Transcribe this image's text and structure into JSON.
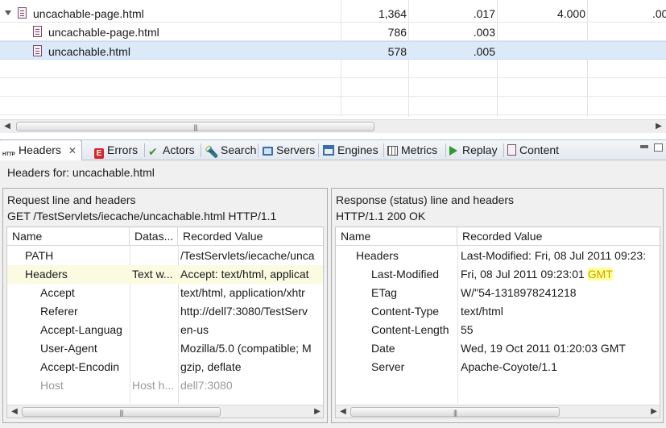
{
  "top_table": {
    "rows": [
      {
        "name": "uncachable-page.html",
        "size": "1,364",
        "time": ".017",
        "col4": "4.000",
        "col5": ".00",
        "expanded": true
      },
      {
        "name": "uncachable-page.html",
        "size": "786",
        "time": ".003",
        "col4": "",
        "col5": ""
      },
      {
        "name": "uncachable.html",
        "size": "578",
        "time": ".005",
        "col4": "",
        "col5": "",
        "selected": true
      }
    ]
  },
  "tabs": [
    {
      "label": "Headers",
      "icon": "http-icon",
      "active": true
    },
    {
      "label": "Errors",
      "icon": "error-icon"
    },
    {
      "label": "Actors",
      "icon": "checkmark-icon"
    },
    {
      "label": "Search",
      "icon": "flashlight-icon"
    },
    {
      "label": "Servers",
      "icon": "monitor-icon"
    },
    {
      "label": "Engines",
      "icon": "engine-icon"
    },
    {
      "label": "Metrics",
      "icon": "grid-icon"
    },
    {
      "label": "Replay",
      "icon": "play-icon"
    },
    {
      "label": "Content",
      "icon": "document-icon"
    }
  ],
  "headers_view": {
    "title": "Headers for: uncachable.html",
    "request": {
      "heading": "Request line and headers",
      "line": "GET /TestServlets/iecache/uncachable.html HTTP/1.1",
      "columns": [
        "Name",
        "Datas...",
        "Recorded Value"
      ],
      "rows": [
        {
          "name": "PATH",
          "datasource": "",
          "value": "/TestServlets/iecache/unca",
          "indent": 1
        },
        {
          "name": "Headers",
          "datasource": "Text w...",
          "value": "Accept: text/html, applicat",
          "indent": 1,
          "highlight": true
        },
        {
          "name": "Accept",
          "datasource": "",
          "value": "text/html, application/xhtr",
          "indent": 2
        },
        {
          "name": "Referer",
          "datasource": "",
          "value": "http://dell7:3080/TestServ",
          "indent": 2
        },
        {
          "name": "Accept-Languag",
          "datasource": "",
          "value": "en-us",
          "indent": 2
        },
        {
          "name": "User-Agent",
          "datasource": "",
          "value": "Mozilla/5.0 (compatible; M",
          "indent": 2
        },
        {
          "name": "Accept-Encodin",
          "datasource": "",
          "value": "gzip, deflate",
          "indent": 2
        },
        {
          "name": "Host",
          "datasource": "Host h...",
          "value": "dell7:3080",
          "indent": 2,
          "muted": true
        }
      ]
    },
    "response": {
      "heading": "Response (status) line and headers",
      "line": "HTTP/1.1 200 OK",
      "columns": [
        "Name",
        "Recorded Value"
      ],
      "rows": [
        {
          "name": "Headers",
          "value": "Last-Modified: Fri, 08 Jul 2011 09:23:",
          "indent": 1
        },
        {
          "name": "Last-Modified",
          "value": "Fri, 08 Jul 2011 09:23:01 ",
          "value_highlight": "GMT",
          "indent": 2
        },
        {
          "name": "ETag",
          "value": "W/\"54-1318978241218",
          "indent": 2
        },
        {
          "name": "Content-Type",
          "value": "text/html",
          "indent": 2
        },
        {
          "name": "Content-Length",
          "value": "55",
          "indent": 2
        },
        {
          "name": "Date",
          "value": "Wed, 19 Oct 2011 01:20:03 GMT",
          "indent": 2
        },
        {
          "name": "Server",
          "value": "Apache-Coyote/1.1",
          "indent": 2
        }
      ]
    }
  },
  "colors": {
    "selection": "#dbe9f8",
    "row_highlight": "#fbfbe1",
    "gmt_highlight": "#ffff99"
  }
}
